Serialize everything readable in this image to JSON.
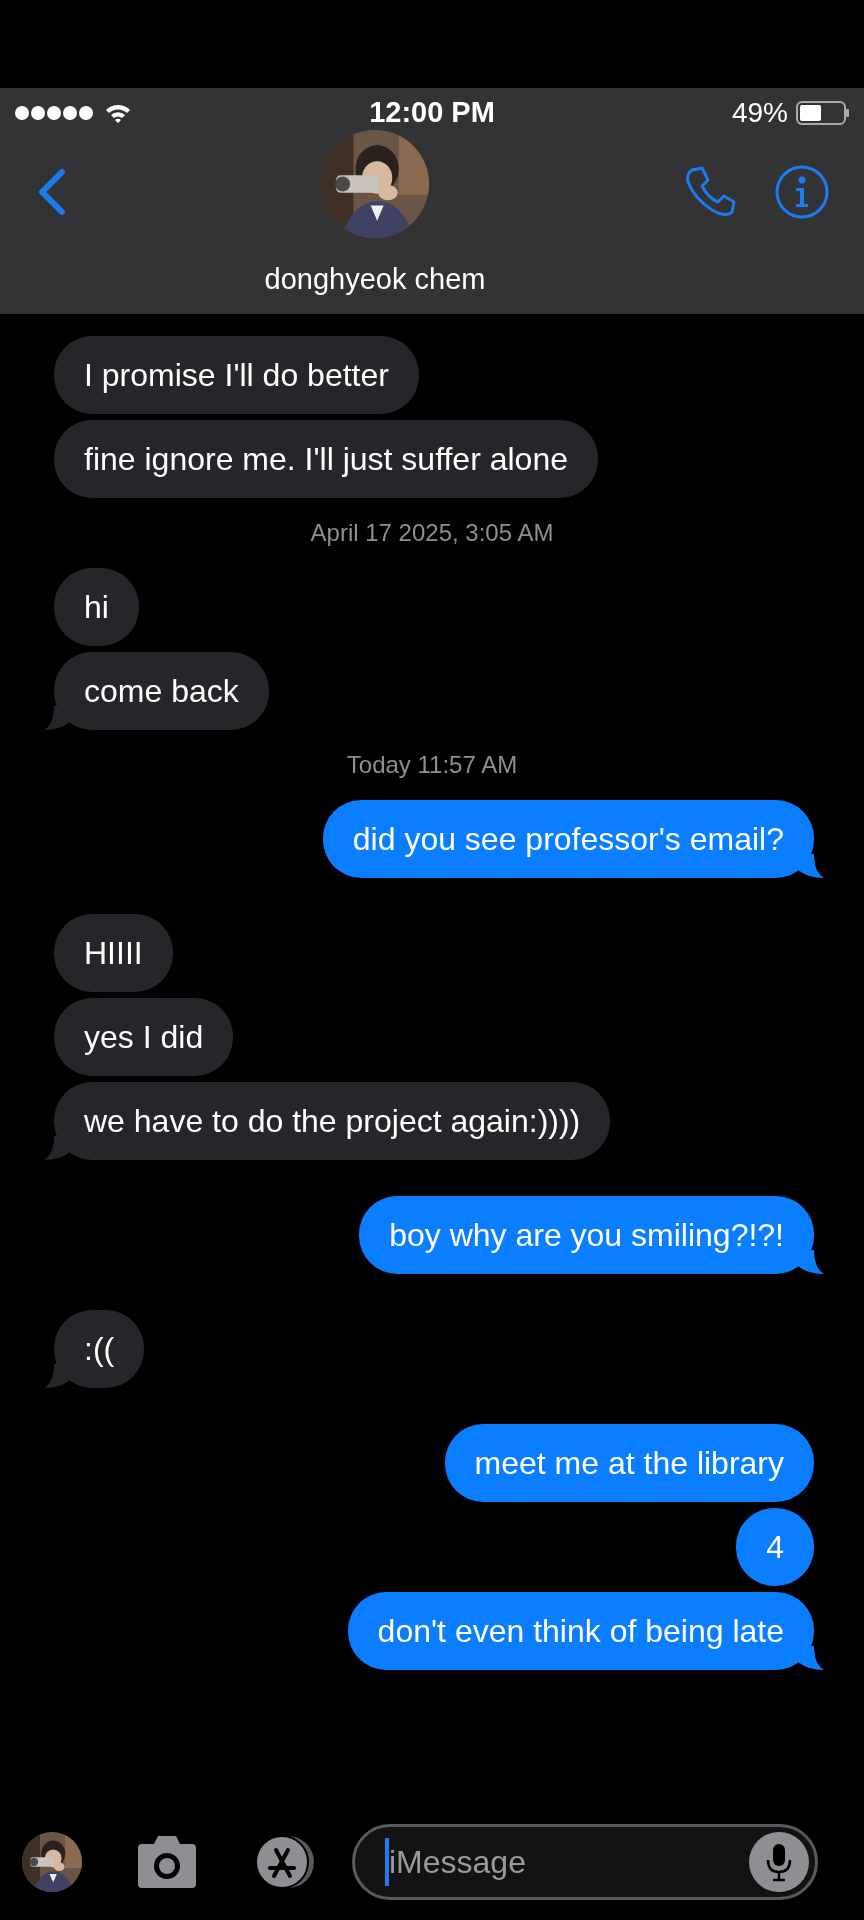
{
  "status_bar": {
    "time": "12:00 PM",
    "battery": "49%"
  },
  "header": {
    "contact_name": "donghyeok chem"
  },
  "messages": [
    {
      "kind": "message",
      "outgoing": false,
      "text": "I promise I'll do better",
      "tail": false
    },
    {
      "kind": "message",
      "outgoing": false,
      "text": "fine ignore me. I'll just suffer alone",
      "tail": false
    },
    {
      "kind": "timestamp",
      "text": "April 17 2025, 3:05 AM"
    },
    {
      "kind": "message",
      "outgoing": false,
      "text": "hi",
      "tail": false
    },
    {
      "kind": "message",
      "outgoing": false,
      "text": "come back",
      "tail": true
    },
    {
      "kind": "timestamp",
      "text": "Today 11:57 AM"
    },
    {
      "kind": "message",
      "outgoing": true,
      "text": "did you see professor's email?",
      "tail": true
    },
    {
      "kind": "message",
      "outgoing": false,
      "text": "HIIII",
      "tail": false
    },
    {
      "kind": "message",
      "outgoing": false,
      "text": "yes I did",
      "tail": false
    },
    {
      "kind": "message",
      "outgoing": false,
      "text": "we have to do the project again:))))",
      "tail": true
    },
    {
      "kind": "message",
      "outgoing": true,
      "text": "boy why are you smiling?!?!",
      "tail": true
    },
    {
      "kind": "message",
      "outgoing": false,
      "text": ":((",
      "tail": true
    },
    {
      "kind": "message",
      "outgoing": true,
      "text": "meet me at the library",
      "tail": false
    },
    {
      "kind": "message",
      "outgoing": true,
      "text": "4",
      "tail": false
    },
    {
      "kind": "message",
      "outgoing": true,
      "text": "don't even think of being late",
      "tail": true
    }
  ],
  "composer": {
    "placeholder": "iMessage"
  }
}
